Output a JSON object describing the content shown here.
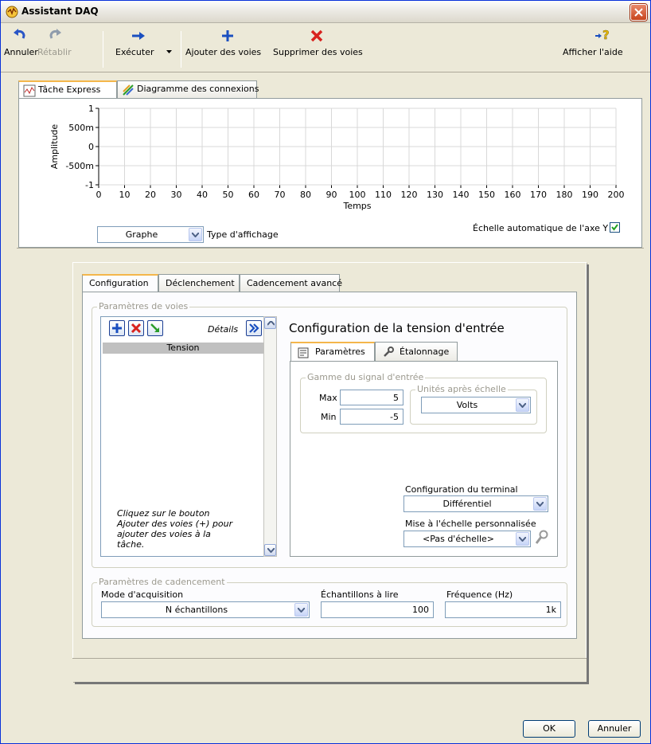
{
  "window": {
    "title": "Assistant DAQ"
  },
  "toolbar": {
    "undo": "Annuler",
    "redo": "Rétablir",
    "run": "Exécuter",
    "add_channels": "Ajouter des voies",
    "remove_channels": "Supprimer des voies",
    "help": "Afficher l'aide"
  },
  "main_tabs": [
    "Tâche Express",
    "Diagramme des connexions"
  ],
  "chart_data": {
    "type": "line",
    "xlabel": "Temps",
    "ylabel": "Amplitude",
    "xlim": [
      0,
      200
    ],
    "ylim": [
      -1,
      1
    ],
    "x_ticks": [
      "0",
      "10",
      "20",
      "30",
      "40",
      "50",
      "60",
      "70",
      "80",
      "90",
      "100",
      "110",
      "120",
      "130",
      "140",
      "150",
      "160",
      "170",
      "180",
      "190",
      "200"
    ],
    "y_ticks": [
      "1",
      "500m",
      "0",
      "-500m",
      "-1"
    ],
    "grid": true,
    "series": []
  },
  "graph_controls": {
    "display_type_value": "Graphe",
    "display_type_label": "Type d'affichage",
    "auto_scale_label": "Échelle automatique de l'axe Y",
    "auto_scale_checked": true
  },
  "config_tabs": [
    "Configuration",
    "Déclenchement",
    "Cadencement avancé"
  ],
  "channel_settings": {
    "group_label": "Paramètres de voies",
    "details_label": "Détails",
    "channels": [
      "Tension"
    ],
    "hint": "Cliquez sur le bouton Ajouter des voies (+) pour ajouter des voies à la tâche."
  },
  "voltage_config": {
    "title": "Configuration de la tension d'entrée",
    "tabs": [
      "Paramètres",
      "Étalonnage"
    ],
    "signal_range_label": "Gamme du signal d'entrée",
    "max_label": "Max",
    "max_value": "5",
    "min_label": "Min",
    "min_value": "-5",
    "units_label": "Unités après échelle",
    "units_value": "Volts",
    "terminal_label": "Configuration du terminal",
    "terminal_value": "Différentiel",
    "scale_label": "Mise à l'échelle personnalisée",
    "scale_value": "<Pas d'échelle>"
  },
  "timing": {
    "group_label": "Paramètres de cadencement",
    "mode_label": "Mode d'acquisition",
    "mode_value": "N échantillons",
    "samples_label": "Échantillons à lire",
    "samples_value": "100",
    "rate_label": "Fréquence (Hz)",
    "rate_value": "1k"
  },
  "footer": {
    "ok": "OK",
    "cancel": "Annuler"
  }
}
